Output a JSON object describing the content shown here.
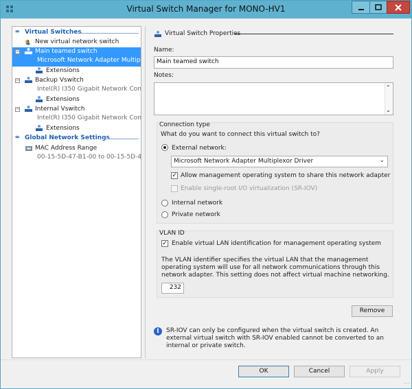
{
  "window": {
    "title": "Virtual Switch Manager for MONO-HV1",
    "accent_color": "#5fb2cf",
    "close_color": "#c7463d"
  },
  "tree": {
    "virtual_switches_header": "Virtual Switches",
    "new_switch": "New virtual network switch",
    "switches": [
      {
        "name": "Main teamed switch",
        "adapter": "Microsoft Network Adapter Multipl...",
        "child": "Extensions",
        "selected": true
      },
      {
        "name": "Backup Vswitch",
        "adapter": "Intel(R) I350 Gigabit Network Con...",
        "child": "Extensions",
        "selected": false
      },
      {
        "name": "Internal Vswitch",
        "adapter": "Intel(R) I350 Gigabit Network Con...",
        "child": "Extensions",
        "selected": false
      }
    ],
    "global_header": "Global Network Settings",
    "mac_range_label": "MAC Address Range",
    "mac_range_value": "00-15-5D-47-B1-00 to 00-15-5D-4..."
  },
  "props": {
    "section_title": "Virtual Switch Properties",
    "name_label": "Name:",
    "name_value": "Main teamed switch",
    "notes_label": "Notes:",
    "notes_value": "",
    "connection_type": {
      "title": "Connection type",
      "question": "What do you want to connect this virtual switch to?",
      "external_label": "External network:",
      "external_selected": true,
      "adapter_value": "Microsoft Network Adapter Multiplexor Driver",
      "allow_mgmt_label": "Allow management operating system to share this network adapter",
      "allow_mgmt_checked": true,
      "sriov_label": "Enable single-root I/O virtualization (SR-IOV)",
      "sriov_checked": false,
      "internal_label": "Internal network",
      "private_label": "Private network"
    },
    "vlan": {
      "title": "VLAN ID",
      "enable_label": "Enable virtual LAN identification for management operating system",
      "enable_checked": true,
      "description": "The VLAN identifier specifies the virtual LAN that the management operating system will use for all network communications through this network adapter. This setting does not affect virtual machine networking.",
      "vlan_id": "232"
    },
    "remove_label": "Remove",
    "info_text": "SR-IOV can only be configured when the virtual switch is created. An external virtual switch with SR-IOV enabled cannot be converted to an internal or private switch."
  },
  "footer": {
    "ok_label": "OK",
    "cancel_label": "Cancel",
    "apply_label": "Apply"
  }
}
